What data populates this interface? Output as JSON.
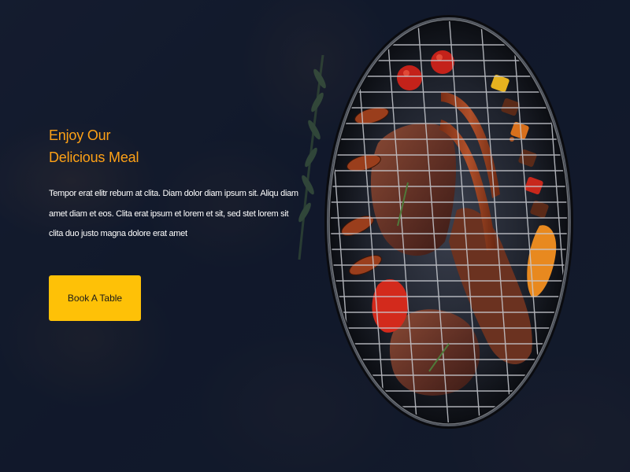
{
  "hero": {
    "title_line1": "Enjoy Our",
    "title_line2": "Delicious Meal",
    "description": "Tempor erat elitr rebum at clita. Diam dolor diam ipsum sit. Aliqu diam amet diam et eos. Clita erat ipsum et lorem et sit, sed stet lorem sit clita duo justo magna dolore erat amet",
    "button_label": "Book A Table"
  },
  "colors": {
    "accent": "#fea116",
    "button": "#fec107",
    "background": "#0f172b",
    "text": "#ffffff"
  },
  "image": {
    "subject": "bbq-grill-icon"
  }
}
